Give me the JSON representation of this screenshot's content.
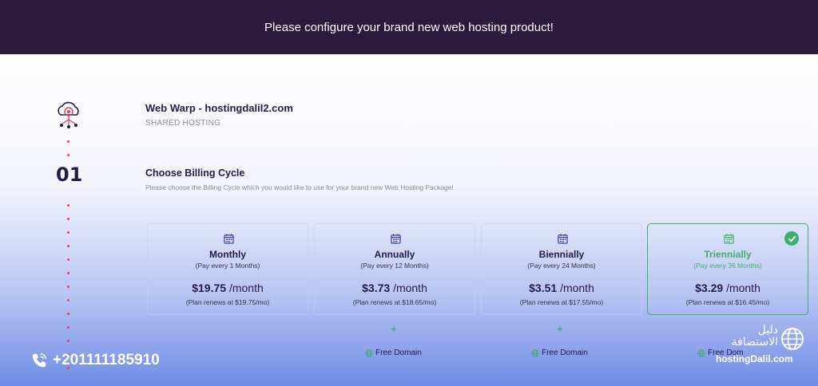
{
  "header": {
    "title": "Please configure your brand new web hosting product!"
  },
  "product": {
    "name": "Web Warp - hostingdalil2.com",
    "type": "SHARED HOSTING"
  },
  "step": {
    "number": "01"
  },
  "billing": {
    "title": "Choose Billing Cycle",
    "description": "Please choose the Billing Cycle which you would like to use for your brand new Web Hosting Package!",
    "cycles": [
      {
        "name": "Monthly",
        "period": "(Pay every 1 Months)",
        "price": "$19.75",
        "unit": "/month",
        "renew": "(Plan renews at $19.75/mo)",
        "selected": false
      },
      {
        "name": "Annually",
        "period": "(Pay every 12 Months)",
        "price": "$3.73",
        "unit": "/month",
        "renew": "(Plan renews at $18.65/mo)",
        "selected": false
      },
      {
        "name": "Biennially",
        "period": "(Pay every 24 Months)",
        "price": "$3.51",
        "unit": "/month",
        "renew": "(Plan renews at $17.55/mo)",
        "selected": false
      },
      {
        "name": "Triennially",
        "period": "(Pay every 36 Months)",
        "price": "$3.29",
        "unit": "/month",
        "renew": "(Plan renews at $16.45/mo)",
        "selected": true
      }
    ],
    "extras": [
      {
        "plus": "+",
        "free_domain": "Free Domain"
      },
      {
        "plus": "+",
        "free_domain": "Free Domain"
      },
      {
        "free_domain": "Free Dom"
      }
    ]
  },
  "contact": {
    "phone": "+201111185910"
  },
  "watermark": {
    "arabic": "دليل الاستضافة",
    "brand": "hostingDalil.com"
  },
  "icons": [
    "cloud-network-icon",
    "calendar-icon",
    "check-icon",
    "plus-icon",
    "globe-icon",
    "phone-icon"
  ],
  "colors": {
    "header_bg": "#2a1a3e",
    "heading": "#241a45",
    "accent_green": "#3fae6f",
    "dot_red": "#e0455e"
  }
}
